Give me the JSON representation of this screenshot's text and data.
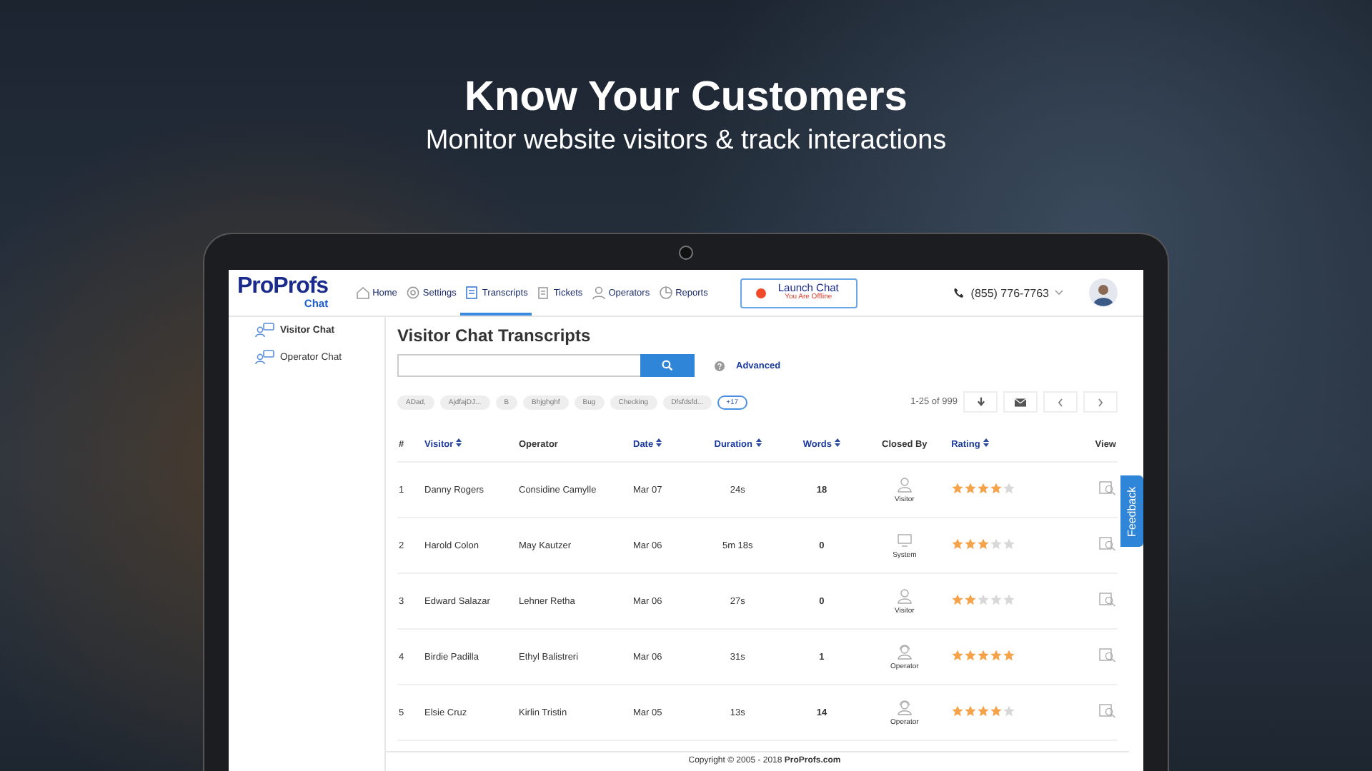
{
  "headline": {
    "title": "Know Your Customers",
    "subtitle": "Monitor website visitors & track interactions"
  },
  "app": {
    "logo": {
      "main": "ProProfs",
      "sub": "Chat"
    },
    "nav": [
      {
        "label": "Home",
        "selected": false
      },
      {
        "label": "Settings",
        "selected": false
      },
      {
        "label": "Transcripts",
        "selected": true
      },
      {
        "label": "Tickets",
        "selected": false
      },
      {
        "label": "Operators",
        "selected": false
      },
      {
        "label": "Reports",
        "selected": false
      }
    ],
    "launch": {
      "label": "Launch Chat",
      "status": "You Are Offline",
      "online": false
    },
    "phone": "(855) 776-7763",
    "sidebar": [
      {
        "label": "Visitor Chat",
        "selected": true
      },
      {
        "label": "Operator Chat",
        "selected": false
      }
    ],
    "page_title": "Visitor Chat Transcripts",
    "advanced": "Advanced",
    "tags": [
      "ADad,",
      "AjdfajDJ...",
      "B",
      "Bhjghghf",
      "Bug",
      "Checking",
      "Dfsfdsfd..."
    ],
    "more_tags": "+17",
    "pager": "1-25 of 999",
    "columns": [
      {
        "label": "#",
        "sortable": false
      },
      {
        "label": "Visitor",
        "sortable": true
      },
      {
        "label": "Operator",
        "sortable": false
      },
      {
        "label": "Date",
        "sortable": true
      },
      {
        "label": "Duration",
        "sortable": true
      },
      {
        "label": "Words",
        "sortable": true
      },
      {
        "label": "Closed By",
        "sortable": false
      },
      {
        "label": "Rating",
        "sortable": true
      },
      {
        "label": "View",
        "sortable": false
      }
    ],
    "rows": [
      {
        "num": "1",
        "visitor": "Danny Rogers",
        "operator": "Considine Camylle",
        "date": "Mar 07",
        "duration": "24s",
        "words": "18",
        "closed_by": {
          "kind": "visitor",
          "label": "Visitor"
        },
        "stars": 4
      },
      {
        "num": "2",
        "visitor": "Harold Colon",
        "operator": "May Kautzer",
        "date": "Mar 06",
        "duration": "5m 18s",
        "words": "0",
        "closed_by": {
          "kind": "system",
          "label": "System"
        },
        "stars": 3
      },
      {
        "num": "3",
        "visitor": "Edward Salazar",
        "operator": "Lehner Retha",
        "date": "Mar 06",
        "duration": "27s",
        "words": "0",
        "closed_by": {
          "kind": "visitor",
          "label": "Visitor"
        },
        "stars": 2
      },
      {
        "num": "4",
        "visitor": "Birdie Padilla",
        "operator": "Ethyl Balistreri",
        "date": "Mar 06",
        "duration": "31s",
        "words": "1",
        "closed_by": {
          "kind": "operator",
          "label": "Operator"
        },
        "stars": 5
      },
      {
        "num": "5",
        "visitor": "Elsie Cruz",
        "operator": "Kirlin Tristin",
        "date": "Mar 05",
        "duration": "13s",
        "words": "14",
        "closed_by": {
          "kind": "operator",
          "label": "Operator"
        },
        "stars": 4
      }
    ],
    "feedback": "Feedback",
    "footer": "Copyright © 2005 - 2018 **ProProfs.com**"
  }
}
